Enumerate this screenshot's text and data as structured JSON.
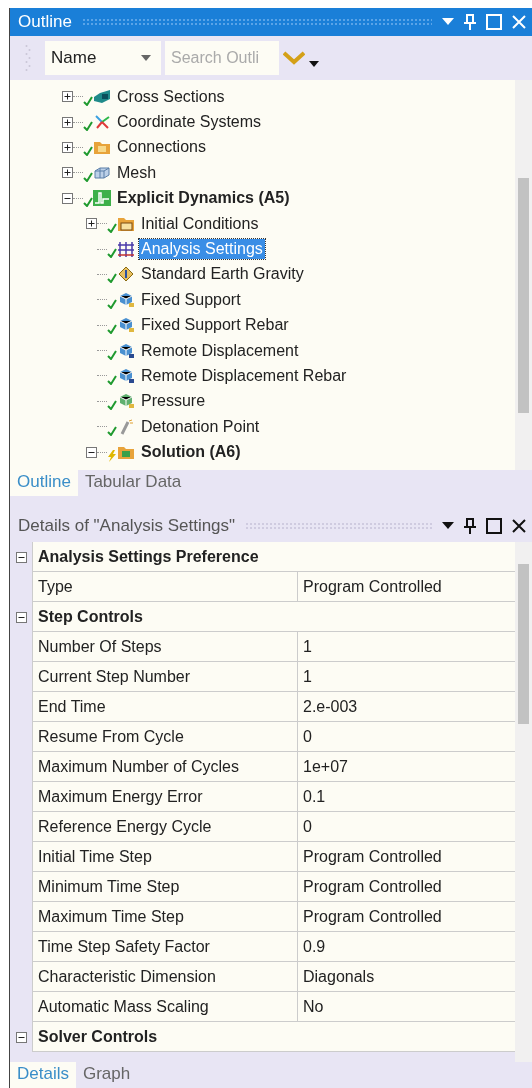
{
  "outline": {
    "title": "Outline",
    "toolbar": {
      "sort_by": "Name",
      "search": {
        "placeholder": "Search Outli"
      }
    },
    "tree": [
      {
        "label": "Cross Sections",
        "kind": "cross-section",
        "solved": true,
        "expanded": false,
        "bold": false,
        "selected": false
      },
      {
        "label": "Coordinate Systems",
        "kind": "coordinate",
        "solved": true,
        "expanded": false,
        "bold": false,
        "selected": false
      },
      {
        "label": "Connections",
        "kind": "folder",
        "solved": true,
        "expanded": false,
        "bold": false,
        "selected": false
      },
      {
        "label": "Mesh",
        "kind": "mesh",
        "solved": true,
        "expanded": false,
        "bold": false,
        "selected": false
      },
      {
        "label": "Explicit Dynamics (A5)",
        "kind": "analysis",
        "solved": true,
        "expanded": true,
        "bold": true,
        "selected": false,
        "children": [
          {
            "label": "Initial Conditions",
            "kind": "initial",
            "solved": true,
            "expanded": false,
            "bold": false,
            "selected": false
          },
          {
            "label": "Analysis Settings",
            "kind": "settings",
            "solved": true,
            "bold": false,
            "selected": true
          },
          {
            "label": "Standard Earth Gravity",
            "kind": "gravity",
            "solved": true,
            "bold": false,
            "selected": false
          },
          {
            "label": "Fixed Support",
            "kind": "support",
            "solved": true,
            "bold": false,
            "selected": false
          },
          {
            "label": "Fixed Support Rebar",
            "kind": "support",
            "solved": true,
            "bold": false,
            "selected": false
          },
          {
            "label": "Remote Displacement",
            "kind": "remote",
            "solved": true,
            "bold": false,
            "selected": false
          },
          {
            "label": "Remote Displacement Rebar",
            "kind": "remote",
            "solved": true,
            "bold": false,
            "selected": false
          },
          {
            "label": "Pressure",
            "kind": "pressure",
            "solved": true,
            "bold": false,
            "selected": false
          },
          {
            "label": "Detonation Point",
            "kind": "detonation",
            "solved": true,
            "bold": false,
            "selected": false
          },
          {
            "label": "Solution (A6)",
            "kind": "solution",
            "solved": false,
            "expanded": true,
            "bold": true,
            "selected": false
          }
        ]
      }
    ],
    "tabs": [
      {
        "label": "Outline",
        "selected": true
      },
      {
        "label": "Tabular Data",
        "selected": false
      }
    ]
  },
  "details": {
    "title": "Details of \"Analysis Settings\"",
    "sections": [
      {
        "title": "Analysis Settings Preference",
        "expanded": true,
        "rows": [
          {
            "name": "Type",
            "value": "Program Controlled"
          }
        ]
      },
      {
        "title": "Step Controls",
        "expanded": true,
        "rows": [
          {
            "name": "Number Of Steps",
            "value": "1"
          },
          {
            "name": "Current Step Number",
            "value": "1"
          },
          {
            "name": "End Time",
            "value": "2.e-003"
          },
          {
            "name": "Resume From Cycle",
            "value": "0"
          },
          {
            "name": "Maximum Number of Cycles",
            "value": "1e+07"
          },
          {
            "name": "Maximum Energy Error",
            "value": "0.1"
          },
          {
            "name": "Reference Energy Cycle",
            "value": "0"
          },
          {
            "name": "Initial Time Step",
            "value": "Program Controlled"
          },
          {
            "name": "Minimum Time Step",
            "value": "Program Controlled"
          },
          {
            "name": "Maximum Time Step",
            "value": "Program Controlled"
          },
          {
            "name": "Time Step Safety Factor",
            "value": "0.9"
          },
          {
            "name": "Characteristic Dimension",
            "value": "Diagonals"
          },
          {
            "name": "Automatic Mass Scaling",
            "value": "No"
          }
        ]
      },
      {
        "title": "Solver Controls",
        "expanded": true
      }
    ],
    "tabs": [
      {
        "label": "Details",
        "selected": true
      },
      {
        "label": "Graph",
        "selected": false
      }
    ]
  }
}
